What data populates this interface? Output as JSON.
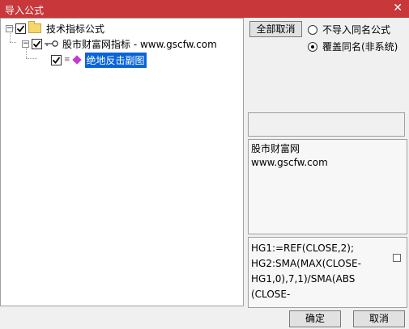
{
  "window": {
    "title": "导入公式",
    "close_glyph": "✕"
  },
  "tree": {
    "root": {
      "label": "技术指标公式",
      "expander": "−",
      "checked": true
    },
    "child": {
      "label": "股市财富网指标 - www.gscfw.com",
      "expander": "−",
      "checked": true
    },
    "leaf": {
      "label": "绝地反击副图",
      "checked": true,
      "selected": true
    }
  },
  "controls": {
    "cancel_all_label": "全部取消",
    "radio_no_import": "不导入同名公式",
    "radio_overwrite": "覆盖同名(非系统)",
    "selected_radio": "overwrite"
  },
  "description": {
    "line1": "股市财富网",
    "line2": "www.gscfw.com"
  },
  "code": {
    "text": "HG1:=REF(CLOSE,2);\nHG2:SMA(MAX(CLOSE-\nHG1,0),7,1)/SMA(ABS\n(CLOSE-"
  },
  "footer": {
    "ok_label": "确定",
    "cancel_label": "取消"
  },
  "colors": {
    "titlebar": "#c8373a",
    "selection": "#0a64d8",
    "diamond": "#c23ad1"
  }
}
